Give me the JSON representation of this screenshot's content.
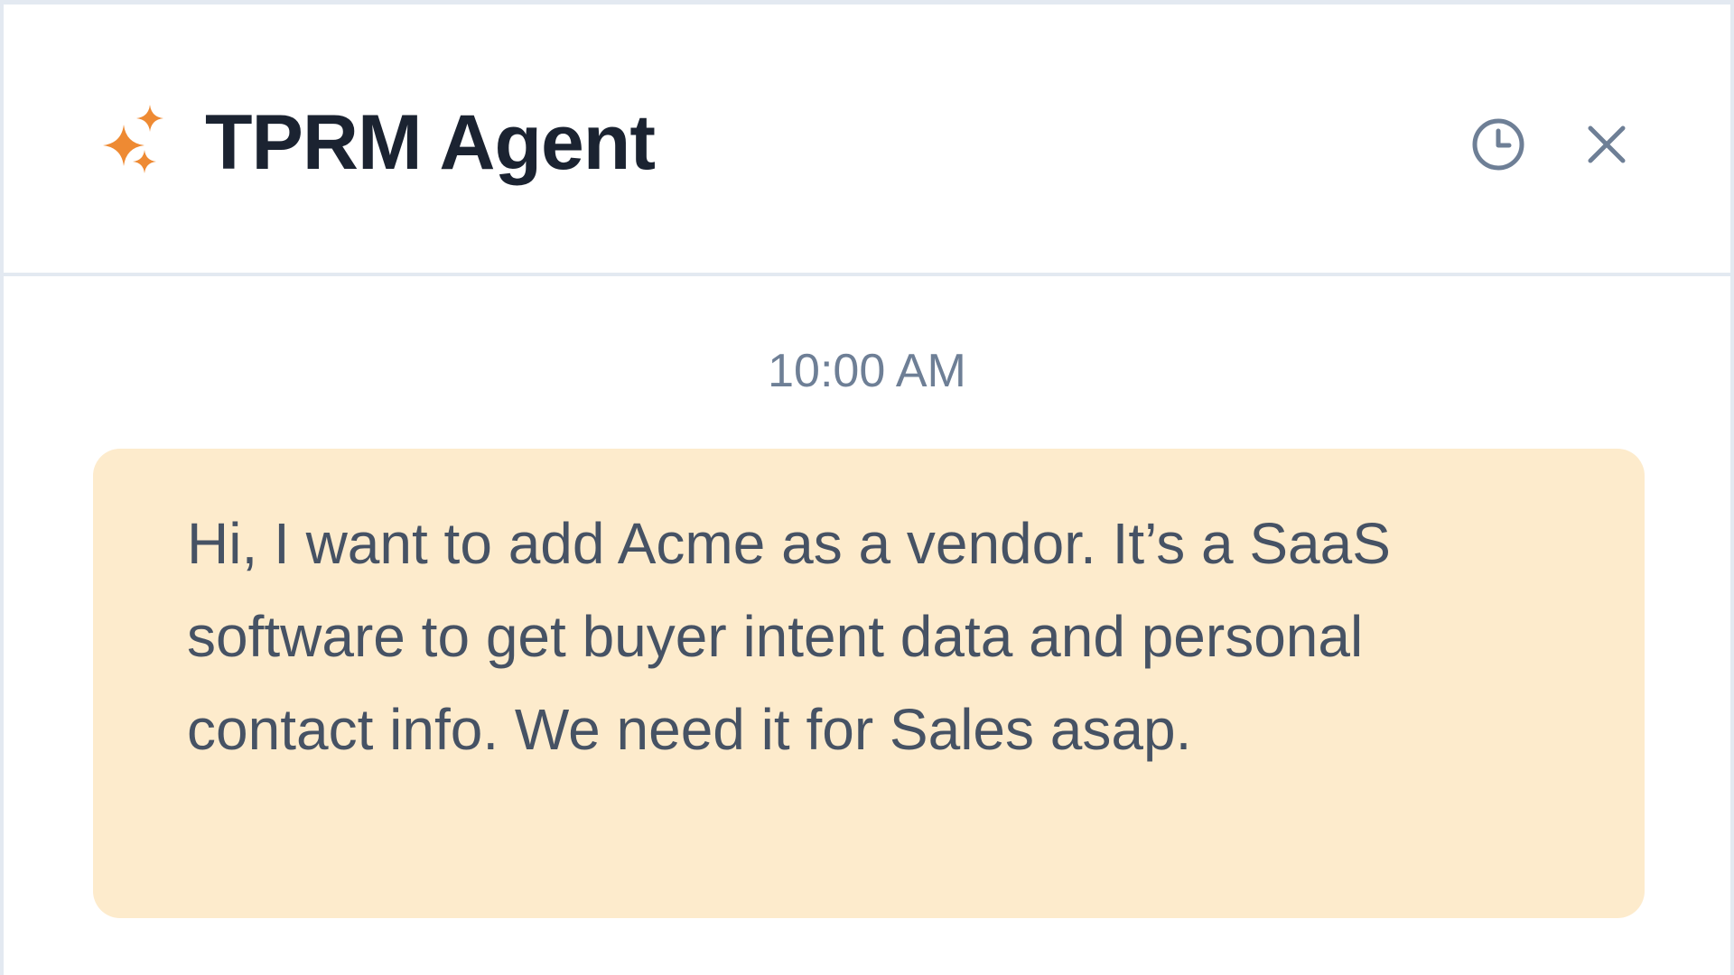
{
  "header": {
    "title": "TPRM Agent",
    "icons": {
      "brand": "sparkle-icon",
      "history": "clock-icon",
      "close": "close-icon"
    }
  },
  "conversation": {
    "messages": [
      {
        "timestamp": "10:00 AM",
        "text": "Hi, I want to add Acme as a vendor. It’s a SaaS software to get buyer intent data and personal contact info. We need it for Sales asap."
      }
    ]
  },
  "colors": {
    "accent": "#ee8a33",
    "title": "#1b2331",
    "icon": "#6e7f96",
    "bubble_background": "#fdebcc",
    "bubble_text": "#465264",
    "border": "#e3e9f1"
  }
}
